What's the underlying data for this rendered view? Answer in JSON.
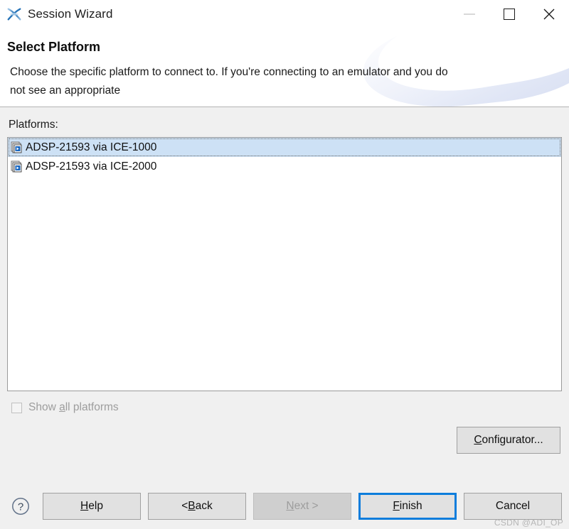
{
  "window": {
    "title": "Session Wizard",
    "app_icon": "crosscore-x-icon",
    "controls": {
      "minimize": "minimize-icon",
      "maximize": "maximize-icon",
      "close": "close-icon"
    }
  },
  "header": {
    "page_title": "Select Platform",
    "description": "Choose the specific platform to connect to.  If you're connecting to an emulator and you do not see an appropriate"
  },
  "main": {
    "platforms_label": "Platforms:",
    "platforms": [
      {
        "label": "ADSP-21593 via ICE-1000",
        "icon": "platform-icon",
        "selected": true
      },
      {
        "label": "ADSP-21593 via ICE-2000",
        "icon": "platform-icon",
        "selected": false
      }
    ],
    "show_all": {
      "label_before": "Show ",
      "mnemonic": "a",
      "label_after": "ll platforms",
      "checked": false,
      "enabled": false
    },
    "configurator": {
      "mnemonic": "C",
      "label_after": "onfigurator..."
    }
  },
  "footer": {
    "help_icon": "question-mark-icon",
    "buttons": [
      {
        "name": "help",
        "before": "",
        "mnemonic": "H",
        "after": "elp",
        "state": "enabled"
      },
      {
        "name": "back",
        "before": "< ",
        "mnemonic": "B",
        "after": "ack",
        "state": "enabled"
      },
      {
        "name": "next",
        "before": "",
        "mnemonic": "N",
        "after": "ext >",
        "state": "disabled"
      },
      {
        "name": "finish",
        "before": "",
        "mnemonic": "F",
        "after": "inish",
        "state": "default"
      },
      {
        "name": "cancel",
        "before": "Cancel",
        "mnemonic": "",
        "after": "",
        "state": "enabled"
      }
    ],
    "watermark": "CSDN @ADI_OP"
  },
  "colors": {
    "accent": "#0d7ddc",
    "selection": "#cde1f5",
    "dialog_bg": "#f0f0f0",
    "button_bg": "#e1e1e1",
    "disabled_text": "#9d9d9d"
  }
}
